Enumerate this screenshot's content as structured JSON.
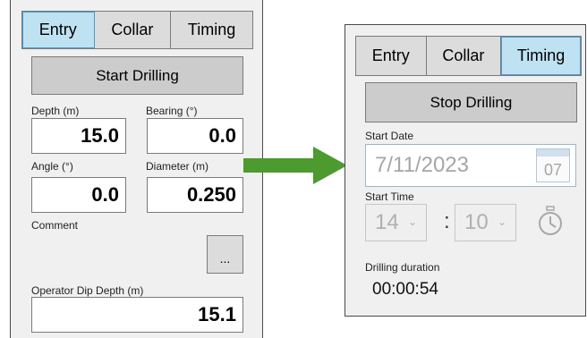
{
  "tabs": [
    "Entry",
    "Collar",
    "Timing"
  ],
  "colors": {
    "active_tab": "#bfe2f3",
    "tab_bg": "#dcdcdc",
    "panel_bg": "#f0f0f0",
    "arrow": "#4d9a2f"
  },
  "left_panel": {
    "active_tab": "Entry",
    "start_button": "Start Drilling",
    "depth": {
      "label": "Depth (m)",
      "value": "15.0"
    },
    "bearing": {
      "label": "Bearing (°)",
      "value": "0.0"
    },
    "angle": {
      "label": "Angle (°)",
      "value": "0.0"
    },
    "diameter": {
      "label": "Diameter (m)",
      "value": "0.250"
    },
    "comment_label": "Comment",
    "comment_button": "...",
    "operator_dip_depth": {
      "label": "Operator Dip Depth (m)",
      "value": "15.1"
    }
  },
  "right_panel": {
    "active_tab": "Timing",
    "stop_button": "Stop Drilling",
    "start_date": {
      "label": "Start Date",
      "value": "7/11/2023",
      "calendar_day": "07"
    },
    "start_time": {
      "label": "Start Time",
      "hour": "14",
      "minute": "10",
      "separator": ":"
    },
    "chevron": "⌄",
    "drilling_duration": {
      "label": "Drilling duration",
      "value": "00:00:54"
    }
  },
  "icons": {
    "arrow": "right-arrow-icon",
    "calendar": "calendar-icon",
    "clock": "clock-icon"
  }
}
